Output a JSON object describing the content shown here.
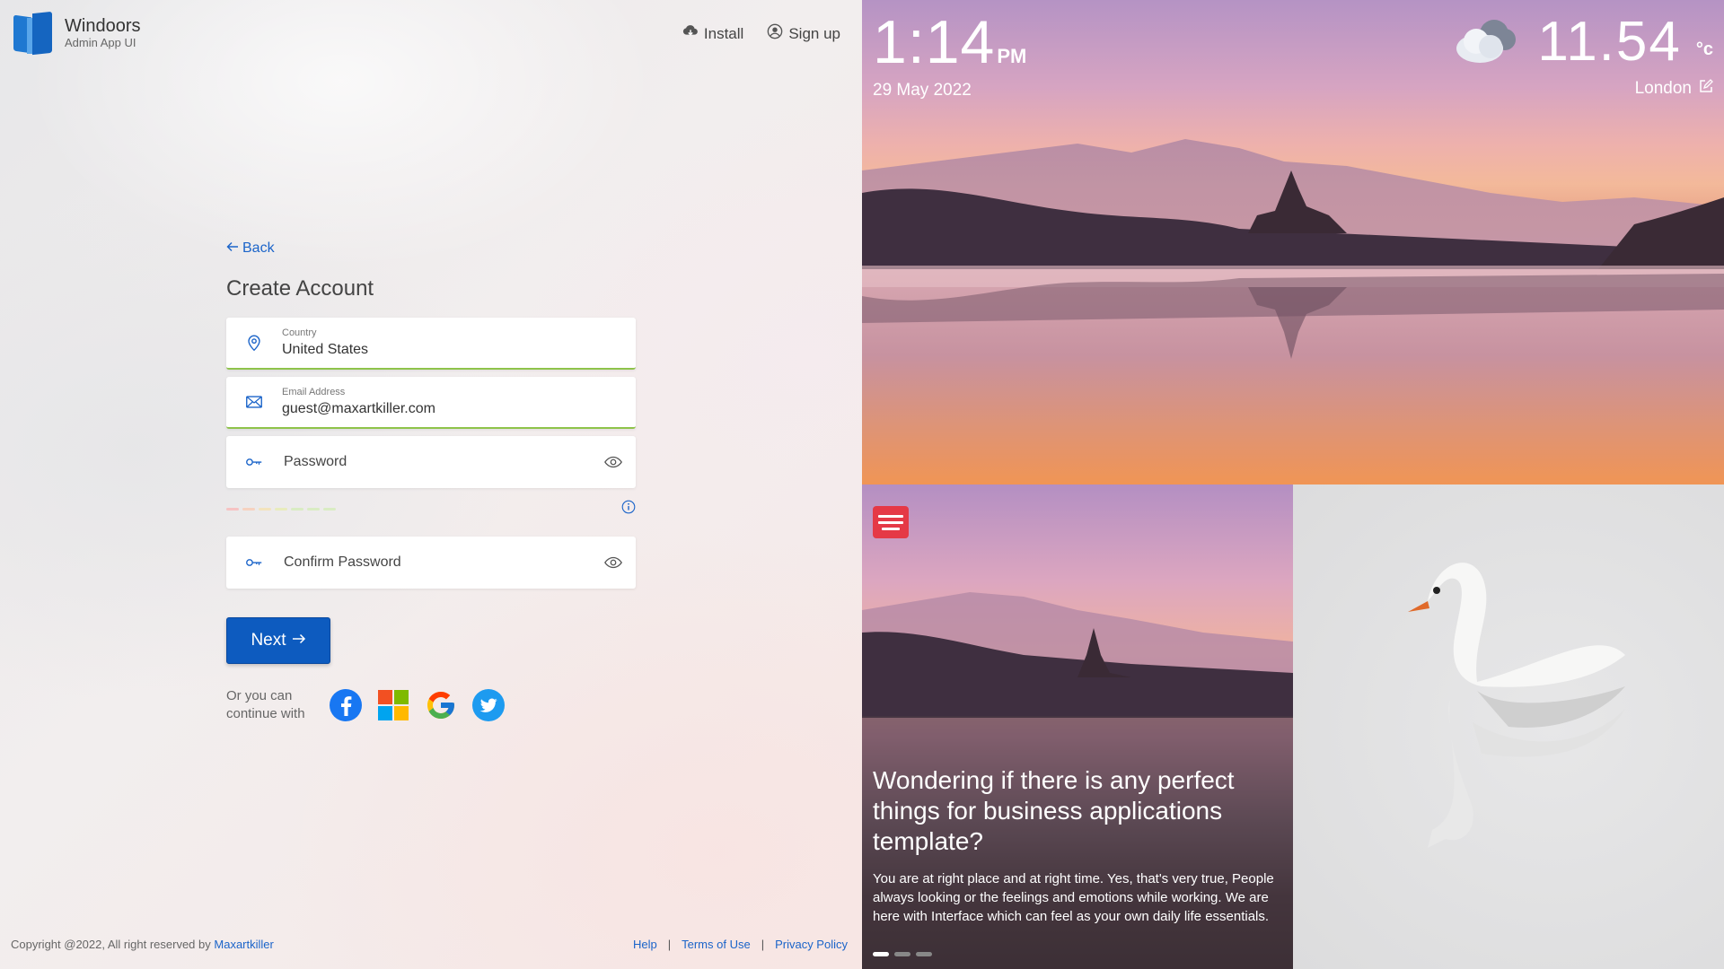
{
  "brand": {
    "name": "Windoors",
    "subtitle": "Admin App UI"
  },
  "top_actions": {
    "install": "Install",
    "signup": "Sign up"
  },
  "form": {
    "back": "Back",
    "title": "Create Account",
    "country": {
      "label": "Country",
      "value": "United States"
    },
    "email": {
      "label": "Email Address",
      "value": "guest@maxartkiller.com"
    },
    "password": {
      "placeholder": "Password"
    },
    "confirm": {
      "placeholder": "Confirm Password"
    },
    "next": "Next",
    "social_text_1": "Or you can",
    "social_text_2": "continue with",
    "social_icons": [
      "facebook-icon",
      "windows-icon",
      "google-icon",
      "twitter-icon"
    ],
    "strength_colors": [
      "#f6c3c3",
      "#f6d2c0",
      "#f3e3bd",
      "#e8ecbd",
      "#d9ecc3"
    ]
  },
  "footer": {
    "copyright": "Copyright @2022, All right reserved by",
    "copyright_link": "Maxartkiller",
    "links": [
      "Help",
      "Terms of Use",
      "Privacy Policy"
    ]
  },
  "hero": {
    "time": "1:14",
    "ampm": "PM",
    "date": "29 May 2022",
    "temperature": "11.54",
    "unit": "°c",
    "city": "London"
  },
  "news": {
    "title": "Wondering if there is any perfect things for business applications template?",
    "body": "You are at right place and at right time. Yes, that's very true, People always looking or the feelings and emotions while working. We are here with Interface which can feel as your own daily life essentials.",
    "slides": 3,
    "active_slide": 1
  },
  "colors": {
    "accent": "#0d5bbf",
    "link": "#1b64c9",
    "valid": "#8ec34a",
    "news_badge": "#e53946"
  }
}
